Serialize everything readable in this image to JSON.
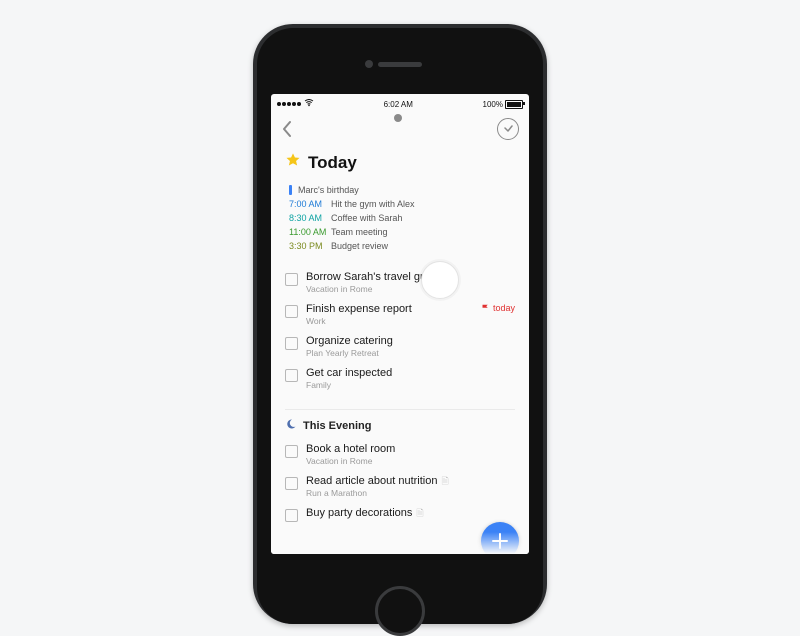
{
  "statusbar": {
    "time": "6:02 AM",
    "battery": "100%"
  },
  "heading": {
    "title": "Today"
  },
  "schedule": [
    {
      "time": "",
      "label": "Marc's birthday",
      "colorClass": "",
      "bar": true
    },
    {
      "time": "7:00 AM",
      "label": "Hit the gym with Alex",
      "colorClass": "t-blue"
    },
    {
      "time": "8:30 AM",
      "label": "Coffee with Sarah",
      "colorClass": "t-teal"
    },
    {
      "time": "11:00 AM",
      "label": "Team meeting",
      "colorClass": "t-green"
    },
    {
      "time": "3:30 PM",
      "label": "Budget review",
      "colorClass": "t-olive"
    }
  ],
  "tasks": [
    {
      "title": "Borrow Sarah's travel guide",
      "sub": "Vacation in Rome"
    },
    {
      "title": "Finish expense report",
      "sub": "Work",
      "flag": "today"
    },
    {
      "title": "Organize catering",
      "sub": "Plan Yearly Retreat"
    },
    {
      "title": "Get car inspected",
      "sub": "Family"
    }
  ],
  "evening": {
    "title": "This Evening",
    "items": [
      {
        "title": "Book a hotel room",
        "sub": "Vacation in Rome"
      },
      {
        "title": "Read article about nutrition",
        "sub": "Run a Marathon",
        "attach": true
      },
      {
        "title": "Buy party decorations",
        "sub": "",
        "attach": true
      }
    ]
  }
}
